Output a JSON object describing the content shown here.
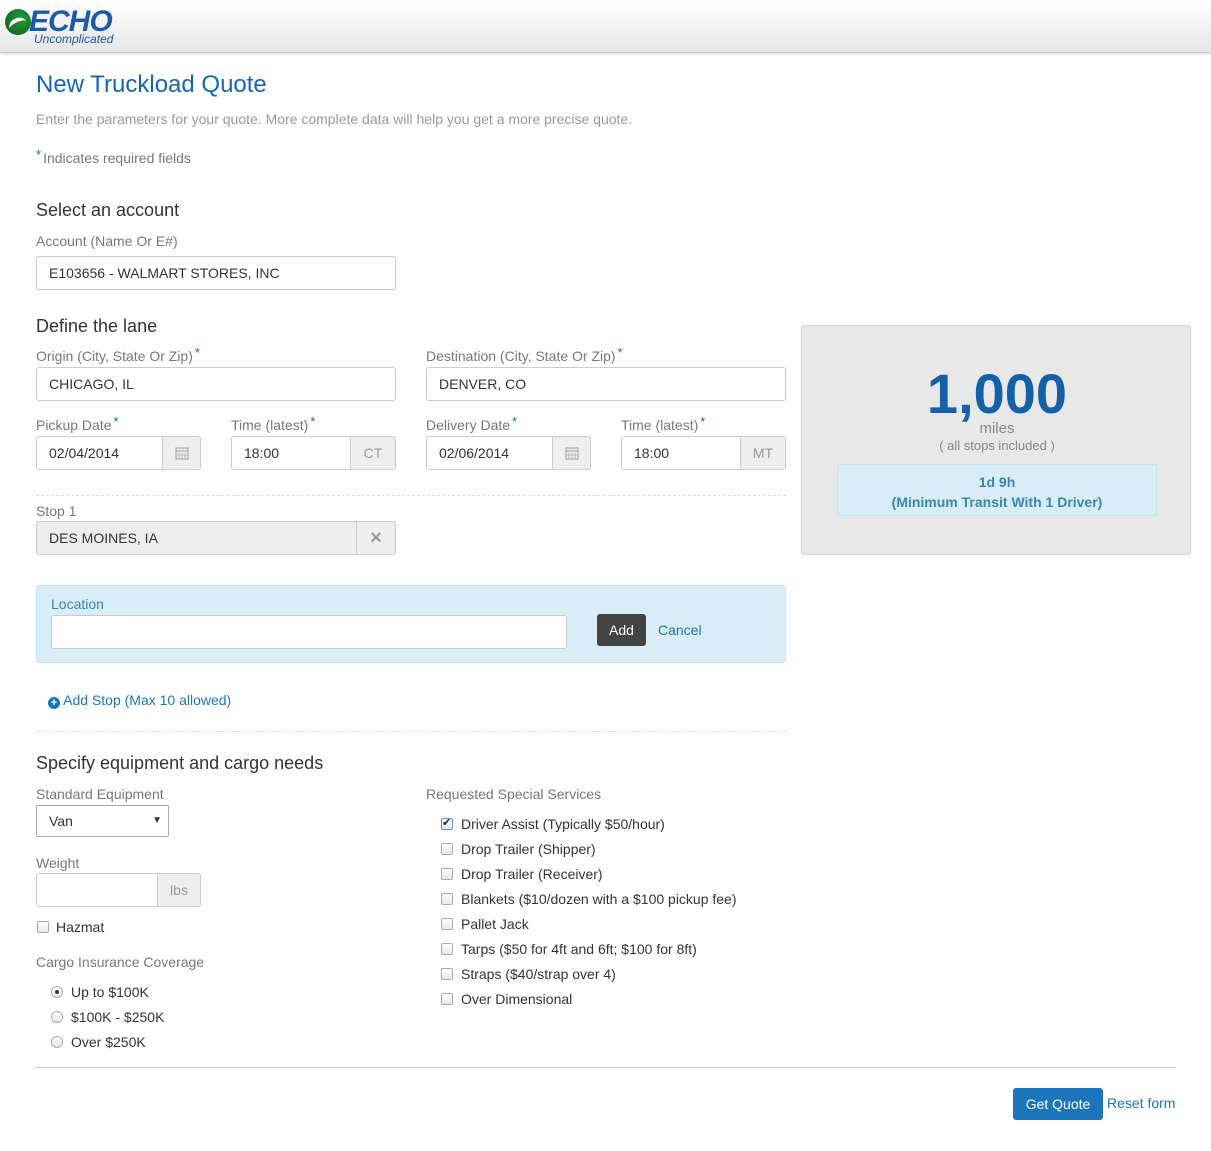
{
  "brand": {
    "name": "ECHO",
    "tagline": "Uncomplicated"
  },
  "page": {
    "title": "New Truckload Quote",
    "subtitle": "Enter the parameters for your quote. More complete data will help you get a more precise quote.",
    "required_marker": "*",
    "required_note": "Indicates required fields"
  },
  "account": {
    "heading": "Select an account",
    "label": "Account (Name Or E#)",
    "value": "E103656 - WALMART STORES, INC"
  },
  "lane": {
    "heading": "Define the lane",
    "origin_label": "Origin (City, State Or Zip)",
    "origin_value": "CHICAGO, IL",
    "destination_label": "Destination (City, State Or Zip)",
    "destination_value": "DENVER, CO",
    "pickup_date_label": "Pickup Date",
    "pickup_date_value": "02/04/2014",
    "pickup_time_label": "Time (latest)",
    "pickup_time_value": "18:00",
    "pickup_tz": "CT",
    "delivery_date_label": "Delivery Date",
    "delivery_date_value": "02/06/2014",
    "delivery_time_label": "Time (latest)",
    "delivery_time_value": "18:00",
    "delivery_tz": "MT",
    "stop1_label": "Stop 1",
    "stop1_value": "DES MOINES, IA",
    "stop_remove_icon": "×",
    "location_label": "Location",
    "location_value": "",
    "add_button": "Add",
    "cancel_link": "Cancel",
    "add_stop_link": "Add Stop (Max 10 allowed)"
  },
  "summary": {
    "miles": "1,000",
    "unit": "miles",
    "note": "( all stops included )",
    "transit_line1": "1d 9h",
    "transit_line2": "(Minimum Transit With 1 Driver)"
  },
  "equipment": {
    "heading": "Specify equipment and cargo needs",
    "standard_label": "Standard Equipment",
    "standard_value": "Van",
    "weight_label": "Weight",
    "weight_value": "",
    "weight_unit": "lbs",
    "hazmat_label": "Hazmat",
    "hazmat_checked": false,
    "insurance_label": "Cargo Insurance Coverage",
    "insurance_options": [
      {
        "label": "Up to $100K",
        "selected": true
      },
      {
        "label": "$100K - $250K",
        "selected": false
      },
      {
        "label": "Over $250K",
        "selected": false
      }
    ],
    "services_label": "Requested Special Services",
    "services": [
      {
        "label": "Driver Assist (Typically $50/hour)",
        "checked": true
      },
      {
        "label": "Drop Trailer (Shipper)",
        "checked": false
      },
      {
        "label": "Drop Trailer (Receiver)",
        "checked": false
      },
      {
        "label": "Blankets ($10/dozen with a $100 pickup fee)",
        "checked": false
      },
      {
        "label": "Pallet Jack",
        "checked": false
      },
      {
        "label": "Tarps ($50 for 4ft and 6ft; $100 for 8ft)",
        "checked": false
      },
      {
        "label": "Straps ($40/strap over 4)",
        "checked": false
      },
      {
        "label": "Over Dimensional",
        "checked": false
      }
    ]
  },
  "actions": {
    "get_quote": "Get Quote",
    "reset": "Reset form"
  },
  "colors": {
    "primary": "#1b75bb",
    "heading": "#1765b0",
    "info_bg": "#d9edf7"
  }
}
